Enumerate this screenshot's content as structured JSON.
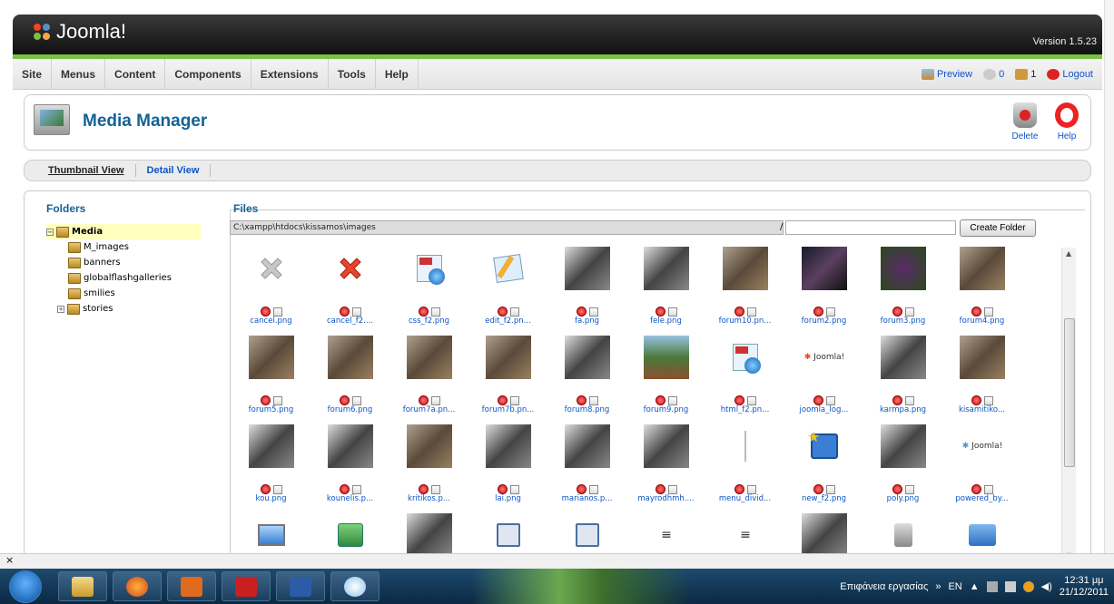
{
  "header": {
    "logo_text": "Joomla!",
    "version": "Version 1.5.23"
  },
  "menu": {
    "items": [
      "Site",
      "Menus",
      "Content",
      "Components",
      "Extensions",
      "Tools",
      "Help"
    ]
  },
  "status": {
    "preview": "Preview",
    "messages": "0",
    "users": "1",
    "logout": "Logout"
  },
  "toolbar": {
    "title": "Media Manager",
    "delete": "Delete",
    "help": "Help"
  },
  "tabs": {
    "thumbnail": "Thumbnail View",
    "detail": "Detail View"
  },
  "folders": {
    "title": "Folders",
    "root": "Media",
    "children": [
      "M_images",
      "banners",
      "globalflashgalleries",
      "smilies",
      "stories"
    ]
  },
  "files": {
    "title": "Files",
    "path": "C:\\xampp\\htdocs\\kissamos\\images",
    "separator": "/",
    "create_folder": "Create Folder",
    "items": [
      {
        "name": "cancel.png",
        "kind": "icon-grayx"
      },
      {
        "name": "cancel_f2....",
        "kind": "icon-redx"
      },
      {
        "name": "css_f2.png",
        "kind": "icon-css"
      },
      {
        "name": "edit_f2.pn...",
        "kind": "icon-edit"
      },
      {
        "name": "fa.png",
        "kind": "photo-bw"
      },
      {
        "name": "fele.png",
        "kind": "photo-bw"
      },
      {
        "name": "forum10.pn...",
        "kind": "photo-color"
      },
      {
        "name": "forum2.png",
        "kind": "photo-dark"
      },
      {
        "name": "forum3.png",
        "kind": "photo-grapes"
      },
      {
        "name": "forum4.png",
        "kind": "photo-color"
      },
      {
        "name": "forum5.png",
        "kind": "photo-color"
      },
      {
        "name": "forum6.png",
        "kind": "photo-color"
      },
      {
        "name": "forum7a.pn...",
        "kind": "photo-color"
      },
      {
        "name": "forum7b.pn...",
        "kind": "photo-color"
      },
      {
        "name": "forum8.png",
        "kind": "photo-bw"
      },
      {
        "name": "forum9.png",
        "kind": "photo-green"
      },
      {
        "name": "html_f2.pn...",
        "kind": "icon-html"
      },
      {
        "name": "joomla_log...",
        "kind": "logo-joomla"
      },
      {
        "name": "karmpa.png",
        "kind": "photo-bw"
      },
      {
        "name": "kisamitiko...",
        "kind": "photo-color"
      },
      {
        "name": "kou.png",
        "kind": "photo-bw"
      },
      {
        "name": "kounelis.p...",
        "kind": "photo-bw"
      },
      {
        "name": "kritikos.p...",
        "kind": "photo-color"
      },
      {
        "name": "lai.png",
        "kind": "photo-bw"
      },
      {
        "name": "marianos.p...",
        "kind": "photo-bw"
      },
      {
        "name": "mayrodhmh....",
        "kind": "photo-bw"
      },
      {
        "name": "menu_divid...",
        "kind": "icon-divider"
      },
      {
        "name": "new_f2.png",
        "kind": "icon-new"
      },
      {
        "name": "poly.png",
        "kind": "photo-bw"
      },
      {
        "name": "powered_by...",
        "kind": "logo-powered"
      },
      {
        "name": "",
        "kind": "icon-monitor"
      },
      {
        "name": "",
        "kind": "icon-green"
      },
      {
        "name": "",
        "kind": "photo-bw"
      },
      {
        "name": "",
        "kind": "icon-save"
      },
      {
        "name": "",
        "kind": "icon-save"
      },
      {
        "name": "",
        "kind": "icon-align"
      },
      {
        "name": "",
        "kind": "icon-align"
      },
      {
        "name": "",
        "kind": "photo-bw"
      },
      {
        "name": "",
        "kind": "icon-bin"
      },
      {
        "name": "",
        "kind": "icon-folder"
      }
    ]
  },
  "bottom_bar": {
    "close": "×"
  },
  "taskbar": {
    "desktop_label": "Επιφάνεια εργασίας",
    "arrows": "»",
    "lang": "EN",
    "time": "12:31 μμ",
    "date": "21/12/2011"
  }
}
